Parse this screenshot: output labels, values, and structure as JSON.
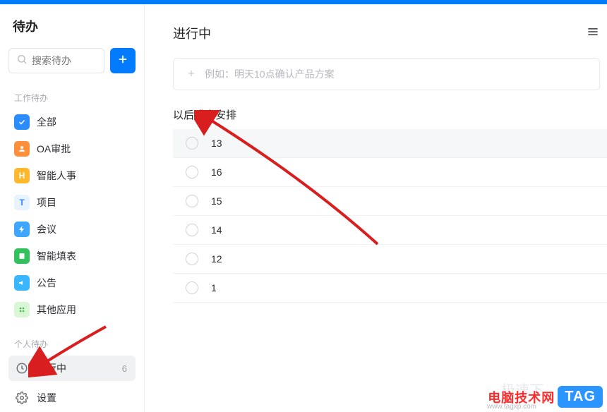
{
  "sidebar": {
    "title": "待办",
    "search_placeholder": "搜索待办",
    "section_work": "工作待办",
    "section_personal": "个人待办",
    "items": [
      {
        "label": "全部",
        "icon_bg": "#2a8cff",
        "icon_glyph": "check"
      },
      {
        "label": "OA审批",
        "icon_bg": "#ff8f3a",
        "icon_glyph": "person"
      },
      {
        "label": "智能人事",
        "icon_bg": "#ffb82e",
        "icon_glyph": "H"
      },
      {
        "label": "项目",
        "icon_bg": "#e9f2ff",
        "icon_glyph": "T",
        "icon_color": "#2a8cff"
      },
      {
        "label": "会议",
        "icon_bg": "#3ea6ff",
        "icon_glyph": "bolt"
      },
      {
        "label": "智能填表",
        "icon_bg": "#33c15e",
        "icon_glyph": "form"
      },
      {
        "label": "公告",
        "icon_bg": "#38b6ff",
        "icon_glyph": "speaker"
      },
      {
        "label": "其他应用",
        "icon_bg": "#d9f7d4",
        "icon_glyph": "grid",
        "icon_color": "#35b24a"
      }
    ],
    "personal_items": [
      {
        "label": "进行中",
        "count": "6"
      }
    ],
    "settings_label": "设置"
  },
  "main": {
    "title": "进行中",
    "add_placeholder": "例如：明天10点确认产品方案",
    "group_label": "以后或未安排",
    "tasks": [
      {
        "label": "13"
      },
      {
        "label": "16"
      },
      {
        "label": "15"
      },
      {
        "label": "14"
      },
      {
        "label": "12"
      },
      {
        "label": "1"
      }
    ]
  },
  "watermark": {
    "text": "电脑技术网",
    "url": "www.tagxp.com",
    "tag": "TAG",
    "faint": "极速下"
  }
}
